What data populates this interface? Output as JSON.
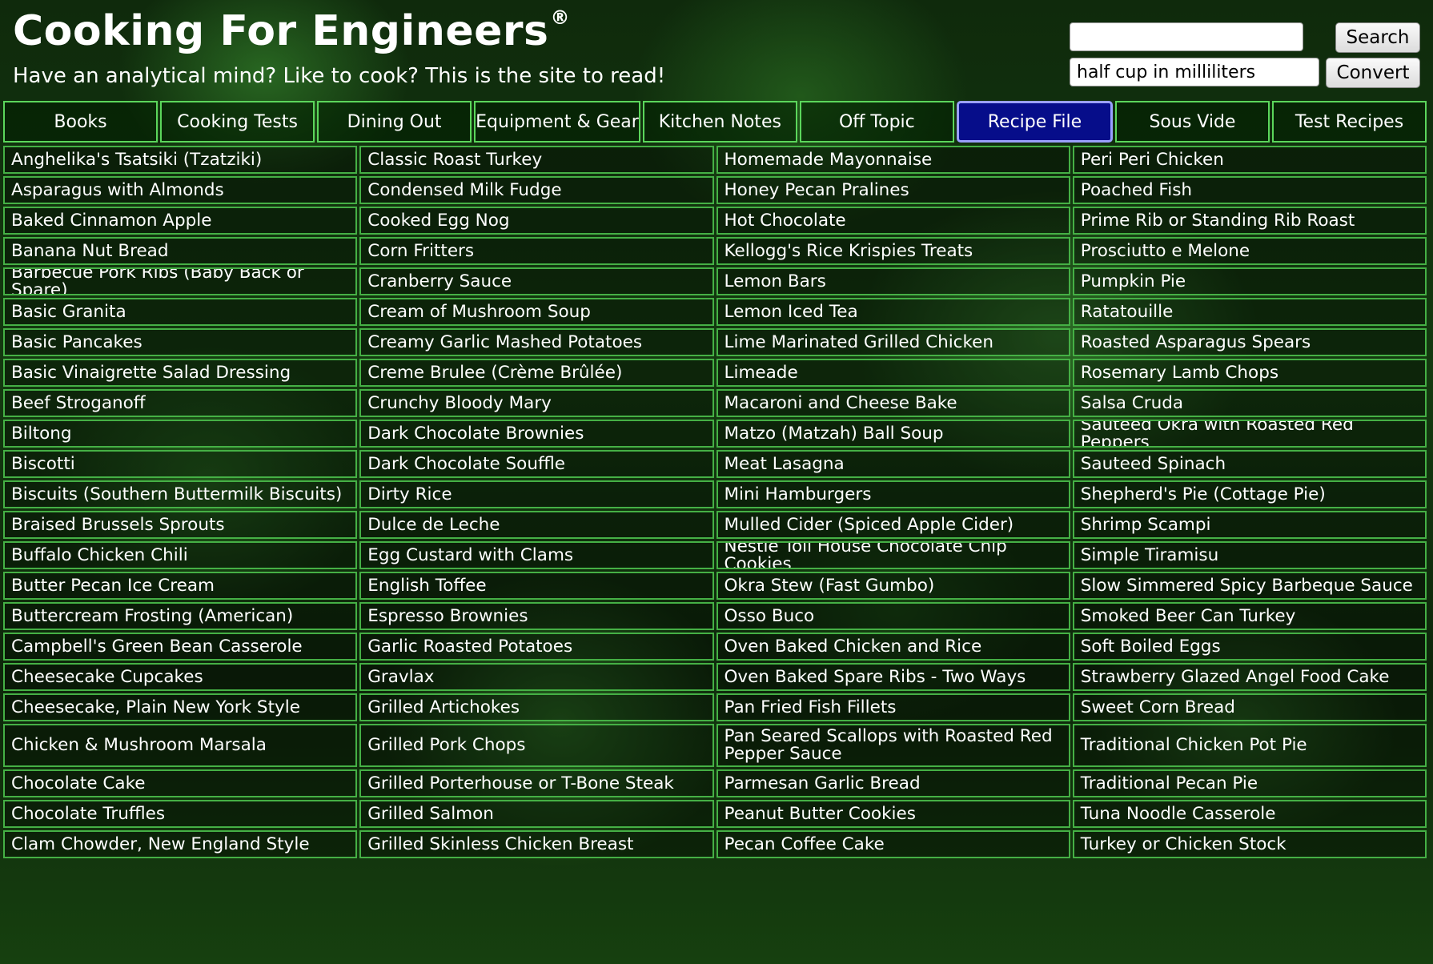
{
  "header": {
    "title": "Cooking For Engineers",
    "trademark": "®",
    "tagline": "Have an analytical mind? Like to cook? This is the site to read!"
  },
  "search": {
    "value": "",
    "button": "Search"
  },
  "convert": {
    "value": "half cup in milliliters",
    "button": "Convert"
  },
  "nav": {
    "active": "Recipe File",
    "tabs": [
      "Books",
      "Cooking Tests",
      "Dining Out",
      "Equipment & Gear",
      "Kitchen Notes",
      "Off Topic",
      "Recipe File",
      "Sous Vide",
      "Test Recipes"
    ]
  },
  "recipes": [
    [
      "Anghelika's Tsatsiki (Tzatziki)",
      "Classic Roast Turkey",
      "Homemade Mayonnaise",
      "Peri Peri Chicken"
    ],
    [
      "Asparagus with Almonds",
      "Condensed Milk Fudge",
      "Honey Pecan Pralines",
      "Poached Fish"
    ],
    [
      "Baked Cinnamon Apple",
      "Cooked Egg Nog",
      "Hot Chocolate",
      "Prime Rib or Standing Rib Roast"
    ],
    [
      "Banana Nut Bread",
      "Corn Fritters",
      "Kellogg's Rice Krispies Treats",
      "Prosciutto e Melone"
    ],
    [
      "Barbecue Pork Ribs (Baby Back or Spare)",
      "Cranberry Sauce",
      "Lemon Bars",
      "Pumpkin Pie"
    ],
    [
      "Basic Granita",
      "Cream of Mushroom Soup",
      "Lemon Iced Tea",
      "Ratatouille"
    ],
    [
      "Basic Pancakes",
      "Creamy Garlic Mashed Potatoes",
      "Lime Marinated Grilled Chicken",
      "Roasted Asparagus Spears"
    ],
    [
      "Basic Vinaigrette Salad Dressing",
      "Creme Brulee (Crème Brûlée)",
      "Limeade",
      "Rosemary Lamb Chops"
    ],
    [
      "Beef Stroganoff",
      "Crunchy Bloody Mary",
      "Macaroni and Cheese Bake",
      "Salsa Cruda"
    ],
    [
      "Biltong",
      "Dark Chocolate Brownies",
      "Matzo (Matzah) Ball Soup",
      "Sauteed Okra with Roasted Red Peppers"
    ],
    [
      "Biscotti",
      "Dark Chocolate Souffle",
      "Meat Lasagna",
      "Sauteed Spinach"
    ],
    [
      "Biscuits (Southern Buttermilk Biscuits)",
      "Dirty Rice",
      "Mini Hamburgers",
      "Shepherd's Pie (Cottage Pie)"
    ],
    [
      "Braised Brussels Sprouts",
      "Dulce de Leche",
      "Mulled Cider (Spiced Apple Cider)",
      "Shrimp Scampi"
    ],
    [
      "Buffalo Chicken Chili",
      "Egg Custard with Clams",
      "Nestle Toll House Chocolate Chip Cookies",
      "Simple Tiramisu"
    ],
    [
      "Butter Pecan Ice Cream",
      "English Toffee",
      "Okra Stew (Fast Gumbo)",
      "Slow Simmered Spicy Barbeque Sauce"
    ],
    [
      "Buttercream Frosting (American)",
      "Espresso Brownies",
      "Osso Buco",
      "Smoked Beer Can Turkey"
    ],
    [
      "Campbell's Green Bean Casserole",
      "Garlic Roasted Potatoes",
      "Oven Baked Chicken and Rice",
      "Soft Boiled Eggs"
    ],
    [
      "Cheesecake Cupcakes",
      "Gravlax",
      "Oven Baked Spare Ribs - Two Ways",
      "Strawberry Glazed Angel Food Cake"
    ],
    [
      "Cheesecake, Plain New York Style",
      "Grilled Artichokes",
      "Pan Fried Fish Fillets",
      "Sweet Corn Bread"
    ],
    [
      "Chicken & Mushroom Marsala",
      "Grilled Pork Chops",
      "Pan Seared Scallops with Roasted Red Pepper Sauce",
      "Traditional Chicken Pot Pie"
    ],
    [
      "Chocolate Cake",
      "Grilled Porterhouse or T-Bone Steak",
      "Parmesan Garlic Bread",
      "Traditional Pecan Pie"
    ],
    [
      "Chocolate Truffles",
      "Grilled Salmon",
      "Peanut Butter Cookies",
      "Tuna Noodle Casserole"
    ],
    [
      "Clam Chowder, New England Style",
      "Grilled Skinless Chicken Breast",
      "Pecan Coffee Cake",
      "Turkey or Chicken Stock"
    ]
  ]
}
